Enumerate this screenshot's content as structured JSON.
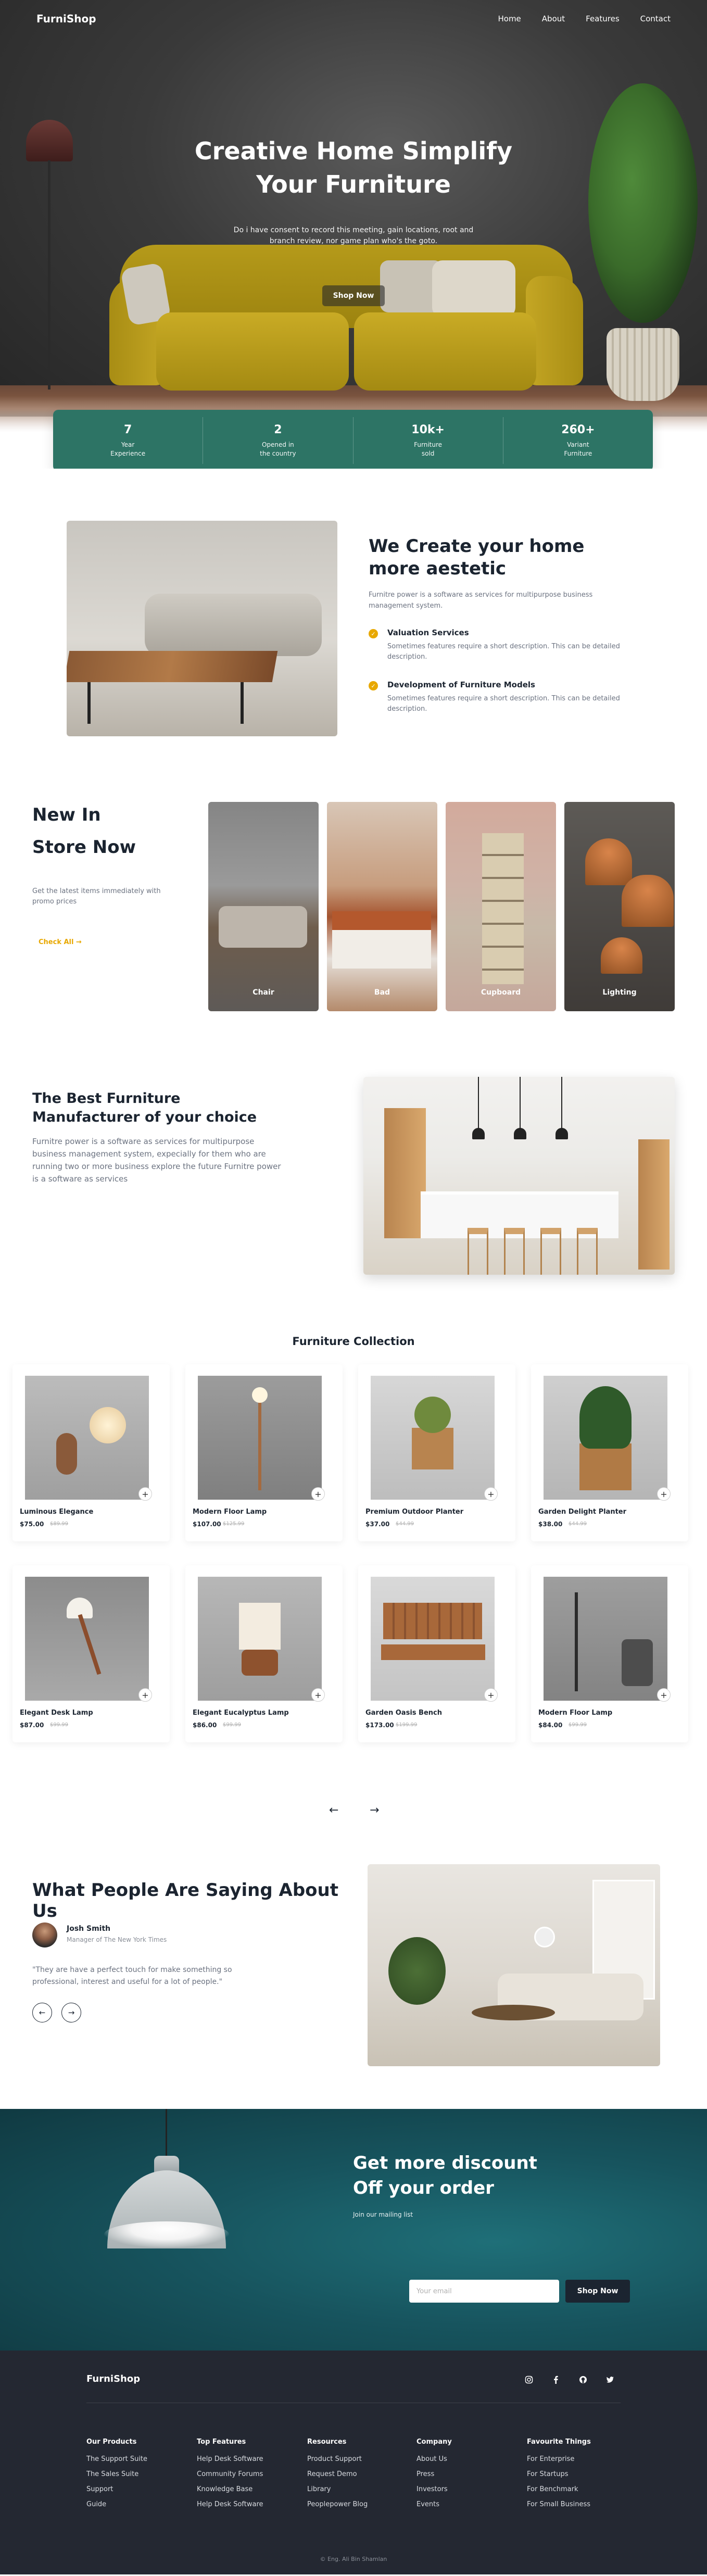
{
  "nav": {
    "logo": "FurniShop",
    "links": [
      "Home",
      "About",
      "Features",
      "Contact"
    ]
  },
  "hero": {
    "title": "Creative Home Simplify Your Furniture",
    "subtitle": "Do i have consent to record this meeting, gain locations, root and branch review, nor game plan who's the goto.",
    "button": "Shop Now"
  },
  "stats": [
    {
      "value": "7",
      "label1": "Year",
      "label2": "Experience"
    },
    {
      "value": "2",
      "label1": "Opened in",
      "label2": "the country"
    },
    {
      "value": "10k+",
      "label1": "Furniture",
      "label2": "sold"
    },
    {
      "value": "260+",
      "label1": "Variant",
      "label2": "Furniture"
    }
  ],
  "about": {
    "title": "We Create your home more aestetic",
    "desc": "Furnitre power is a software as services for multipurpose business management system.",
    "features": [
      {
        "title": "Valuation Services",
        "desc": "Sometimes features require a short description. This can be detailed description."
      },
      {
        "title": "Development of Furniture Models",
        "desc": "Sometimes features require a short description. This can be detailed description."
      }
    ]
  },
  "newin": {
    "title1": "New In",
    "title2": "Store Now",
    "desc": "Get the latest items immediately with promo prices",
    "link": "Check All",
    "categories": [
      "Chair",
      "Bad",
      "Cupboard",
      "Lighting"
    ]
  },
  "best": {
    "title": "The Best Furniture Manufacturer of your choice",
    "desc": "Furnitre power is a software as services for multipurpose business management system, expecially for them who are running two or more business explore the future Furnitre power is a software as services"
  },
  "collection": {
    "title": "Furniture Collection",
    "products": [
      {
        "name": "Luminous Elegance",
        "price": "$75.00",
        "old": "$89.99"
      },
      {
        "name": "Modern Floor Lamp",
        "price": "$107.00",
        "old": "$125.99"
      },
      {
        "name": "Premium Outdoor Planter",
        "price": "$37.00",
        "old": "$44.99"
      },
      {
        "name": "Garden Delight Planter",
        "price": "$38.00",
        "old": "$44.99"
      },
      {
        "name": "Elegant Desk Lamp",
        "price": "$87.00",
        "old": "$99.99"
      },
      {
        "name": "Elegant Eucalyptus Lamp",
        "price": "$86.00",
        "old": "$99.99"
      },
      {
        "name": "Garden Oasis Bench",
        "price": "$173.00",
        "old": "$199.99"
      },
      {
        "name": "Modern Floor Lamp",
        "price": "$84.00",
        "old": "$99.99"
      }
    ],
    "prev": "←",
    "next": "→"
  },
  "testimonial": {
    "title": "What People Are Saying About Us",
    "name": "Josh Smith",
    "role": "Manager of The New York Times",
    "quote": "\"They are have a perfect touch for make something so professional, interest and useful for a lot of people.\"",
    "prev": "←",
    "next": "→"
  },
  "discount": {
    "title1": "Get more discount",
    "title2": "Off your order",
    "subtitle": "Join our mailing list",
    "placeholder": "Your email",
    "button": "Shop Now"
  },
  "footer": {
    "logo": "FurniShop",
    "social_icons": [
      "instagram-icon",
      "facebook-icon",
      "github-icon",
      "twitter-icon"
    ],
    "columns": [
      {
        "title": "Our Products",
        "items": [
          "The Support Suite",
          "The Sales Suite",
          "Support",
          "Guide"
        ]
      },
      {
        "title": "Top Features",
        "items": [
          "Help Desk Software",
          "Community Forums",
          "Knowledge Base",
          "Help Desk Software"
        ]
      },
      {
        "title": "Resources",
        "items": [
          "Product Support",
          "Request Demo",
          "Library",
          "Peoplepower Blog"
        ]
      },
      {
        "title": "Company",
        "items": [
          "About Us",
          "Press",
          "Investors",
          "Events"
        ]
      },
      {
        "title": "Favourite Things",
        "items": [
          "For Enterprise",
          "For Startups",
          "For Benchmark",
          "For Small Business"
        ]
      }
    ],
    "copyright": "© Eng. Ali Bin Shamlan"
  },
  "colors": {
    "accent_green": "#2d7465",
    "accent_gold": "#e8a800",
    "dark": "#1b2430",
    "footer_bg": "#242832",
    "discount_bg": "#17545e"
  }
}
